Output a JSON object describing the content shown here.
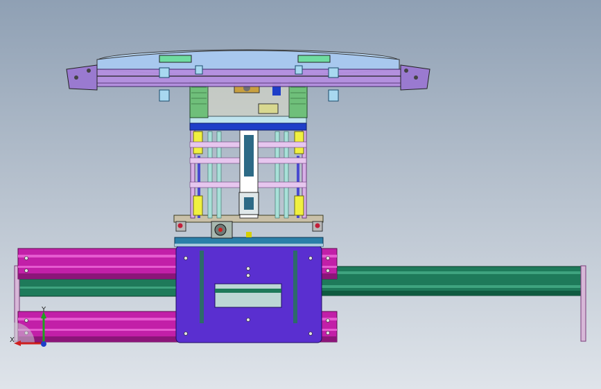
{
  "viewport": {
    "background_top": "#8fa0b4",
    "background_bottom": "#dfe4ea"
  },
  "model": {
    "colors": {
      "turntable_top": "#b9d8f5",
      "turntable_purple": "#b58fe0",
      "column_green": "#6fbf7a",
      "cylinder_yellow": "#f0f040",
      "rail_magenta": "#c21fa8",
      "rail_green": "#1e7a5a",
      "base_plate_blue": "#5a2fd0",
      "frame_pink": "#d8b0e8"
    }
  },
  "triad": {
    "y_label": "Y",
    "x_label": "X"
  }
}
